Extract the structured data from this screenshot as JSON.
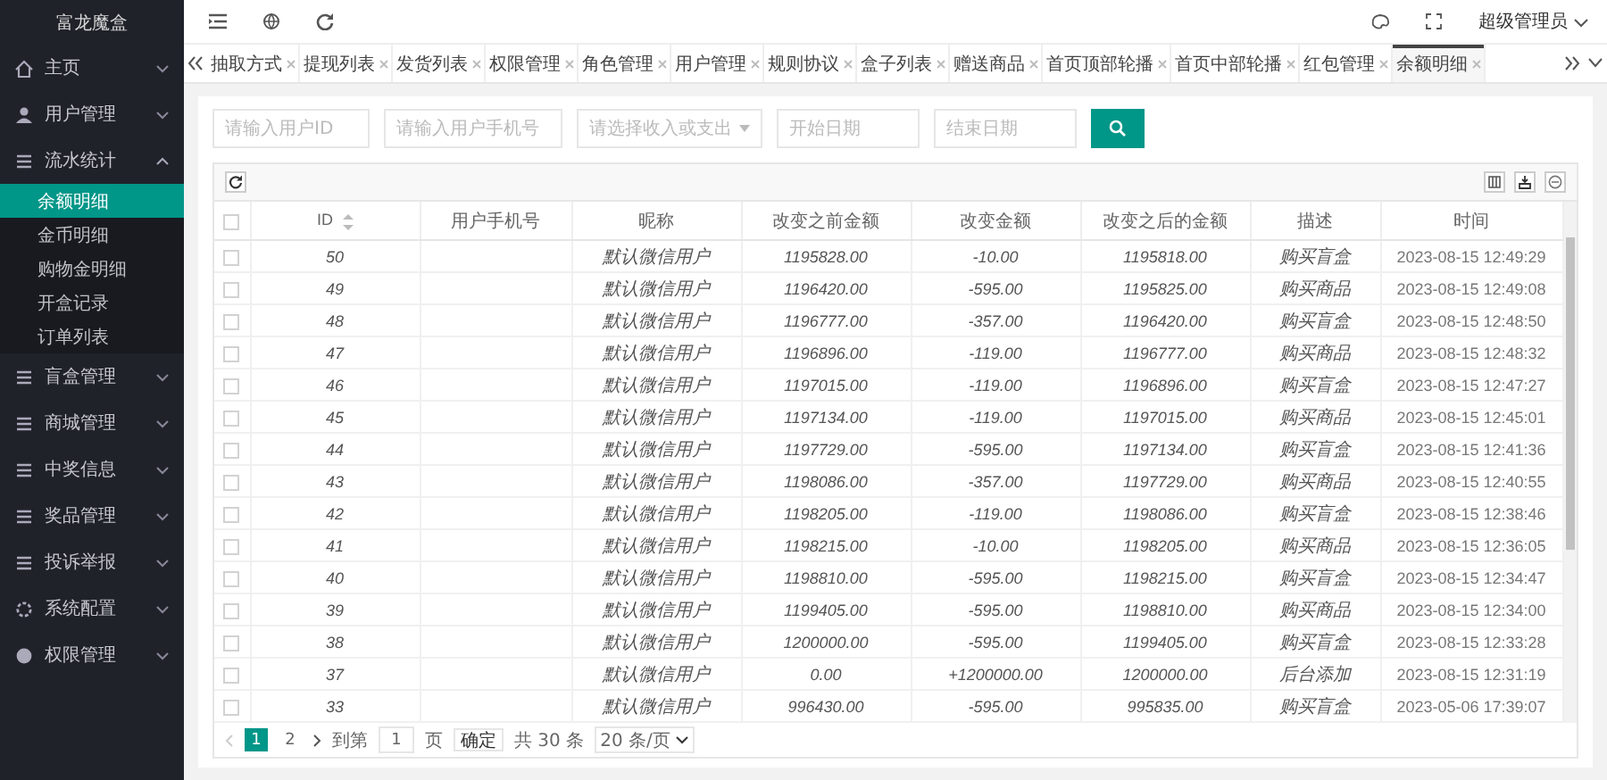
{
  "sidebar": {
    "title": "富龙魔盒",
    "items": [
      {
        "label": "主页",
        "expanded": false
      },
      {
        "label": "用户管理",
        "expanded": false
      },
      {
        "label": "流水统计",
        "expanded": true,
        "children": [
          {
            "label": "余额明细",
            "selected": true
          },
          {
            "label": "金币明细",
            "selected": false
          },
          {
            "label": "购物金明细",
            "selected": false
          },
          {
            "label": "开盒记录",
            "selected": false
          },
          {
            "label": "订单列表",
            "selected": false
          }
        ]
      },
      {
        "label": "盲盒管理",
        "expanded": false
      },
      {
        "label": "商城管理",
        "expanded": false
      },
      {
        "label": "中奖信息",
        "expanded": false
      },
      {
        "label": "奖品管理",
        "expanded": false
      },
      {
        "label": "投诉举报",
        "expanded": false
      },
      {
        "label": "系统配置",
        "expanded": false
      },
      {
        "label": "权限管理",
        "expanded": false
      }
    ]
  },
  "header": {
    "user": "超级管理员"
  },
  "tabs": [
    {
      "label": "抽取方式",
      "selected": false
    },
    {
      "label": "提现列表",
      "selected": false
    },
    {
      "label": "发货列表",
      "selected": false
    },
    {
      "label": "权限管理",
      "selected": false
    },
    {
      "label": "角色管理",
      "selected": false
    },
    {
      "label": "用户管理",
      "selected": false
    },
    {
      "label": "规则协议",
      "selected": false
    },
    {
      "label": "盒子列表",
      "selected": false
    },
    {
      "label": "赠送商品",
      "selected": false
    },
    {
      "label": "首页顶部轮播",
      "selected": false
    },
    {
      "label": "首页中部轮播",
      "selected": false
    },
    {
      "label": "红包管理",
      "selected": false
    },
    {
      "label": "余额明细",
      "selected": true
    }
  ],
  "filters": [
    {
      "kind": "input",
      "placeholder": "请输入用户ID"
    },
    {
      "kind": "input",
      "placeholder": "请输入用户手机号"
    },
    {
      "kind": "select",
      "placeholder": "请选择收入或支出"
    },
    {
      "kind": "date",
      "placeholder": "开始日期"
    },
    {
      "kind": "date",
      "placeholder": "结束日期"
    }
  ],
  "table": {
    "columns": [
      "ID",
      "用户手机号",
      "昵称",
      "改变之前金额",
      "改变金额",
      "改变之后的金额",
      "描述",
      "时间"
    ],
    "header_checked": false,
    "rows": [
      {
        "checked": false,
        "cells": [
          "50",
          "",
          "默认微信用户",
          "1195828.00",
          "-10.00",
          "1195818.00",
          "购买盲盒",
          "2023-08-15 12:49:29"
        ]
      },
      {
        "checked": false,
        "cells": [
          "49",
          "",
          "默认微信用户",
          "1196420.00",
          "-595.00",
          "1195825.00",
          "购买商品",
          "2023-08-15 12:49:08"
        ]
      },
      {
        "checked": false,
        "cells": [
          "48",
          "",
          "默认微信用户",
          "1196777.00",
          "-357.00",
          "1196420.00",
          "购买盲盒",
          "2023-08-15 12:48:50"
        ]
      },
      {
        "checked": false,
        "cells": [
          "47",
          "",
          "默认微信用户",
          "1196896.00",
          "-119.00",
          "1196777.00",
          "购买商品",
          "2023-08-15 12:48:32"
        ]
      },
      {
        "checked": false,
        "cells": [
          "46",
          "",
          "默认微信用户",
          "1197015.00",
          "-119.00",
          "1196896.00",
          "购买盲盒",
          "2023-08-15 12:47:27"
        ]
      },
      {
        "checked": false,
        "cells": [
          "45",
          "",
          "默认微信用户",
          "1197134.00",
          "-119.00",
          "1197015.00",
          "购买商品",
          "2023-08-15 12:45:01"
        ]
      },
      {
        "checked": false,
        "cells": [
          "44",
          "",
          "默认微信用户",
          "1197729.00",
          "-595.00",
          "1197134.00",
          "购买盲盒",
          "2023-08-15 12:41:36"
        ]
      },
      {
        "checked": false,
        "cells": [
          "43",
          "",
          "默认微信用户",
          "1198086.00",
          "-357.00",
          "1197729.00",
          "购买商品",
          "2023-08-15 12:40:55"
        ]
      },
      {
        "checked": false,
        "cells": [
          "42",
          "",
          "默认微信用户",
          "1198205.00",
          "-119.00",
          "1198086.00",
          "购买盲盒",
          "2023-08-15 12:38:46"
        ]
      },
      {
        "checked": false,
        "cells": [
          "41",
          "",
          "默认微信用户",
          "1198215.00",
          "-10.00",
          "1198205.00",
          "购买商品",
          "2023-08-15 12:36:05"
        ]
      },
      {
        "checked": false,
        "cells": [
          "40",
          "",
          "默认微信用户",
          "1198810.00",
          "-595.00",
          "1198215.00",
          "购买盲盒",
          "2023-08-15 12:34:47"
        ]
      },
      {
        "checked": false,
        "cells": [
          "39",
          "",
          "默认微信用户",
          "1199405.00",
          "-595.00",
          "1198810.00",
          "购买商品",
          "2023-08-15 12:34:00"
        ]
      },
      {
        "checked": false,
        "cells": [
          "38",
          "",
          "默认微信用户",
          "1200000.00",
          "-595.00",
          "1199405.00",
          "购买盲盒",
          "2023-08-15 12:33:28"
        ]
      },
      {
        "checked": false,
        "cells": [
          "37",
          "",
          "默认微信用户",
          "0.00",
          "+1200000.00",
          "1200000.00",
          "后台添加",
          "2023-08-15 12:31:19"
        ]
      },
      {
        "checked": false,
        "cells": [
          "33",
          "",
          "默认微信用户",
          "996430.00",
          "-595.00",
          "995835.00",
          "购买盲盒",
          "2023-05-06 17:39:07"
        ]
      }
    ]
  },
  "pagination": {
    "pages": [
      {
        "label": "1",
        "selected": true
      },
      {
        "label": "2",
        "selected": false
      }
    ],
    "goto_label": "到第",
    "goto_value": "1",
    "page_unit": "页",
    "confirm": "确定",
    "total": "共 30 条",
    "page_size": "20 条/页"
  }
}
